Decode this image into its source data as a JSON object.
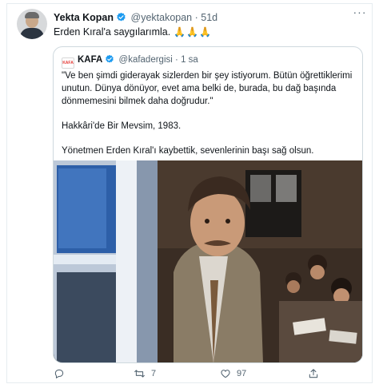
{
  "tweet": {
    "author_name": "Yekta Kopan",
    "author_handle": "@yektakopan",
    "separator": "·",
    "time": "51d",
    "text": "Erden Kıral'a saygılarımla.",
    "emoji": "🙏🙏🙏"
  },
  "quoted": {
    "logo_text": "KAFA",
    "author_name": "KAFA",
    "author_handle": "@kafadergisi",
    "separator": "·",
    "time": "1 sa",
    "paragraph_1": "\"Ve ben şimdi giderayak sizlerden bir şey istiyorum. Bütün öğrettiklerimi unutun. Dünya dönüyor, evet ama belki de, burada, bu dağ başında dönmemesini bilmek daha doğrudur.\"",
    "paragraph_2": "Hakkâri'de Bir Mevsim, 1983.",
    "paragraph_3": "Yönetmen Erden Kıral'ı kaybettik, sevenlerinin başı sağ olsun."
  },
  "actions": {
    "reply_count": "",
    "retweet_count": "7",
    "like_count": "97"
  },
  "colors": {
    "verified": "#1d9bf0",
    "secondary_text": "#536471",
    "border": "#cfd9de"
  },
  "icons": [
    "verified-badge-icon",
    "more-options-icon",
    "reply-icon",
    "retweet-icon",
    "like-icon",
    "share-icon"
  ]
}
